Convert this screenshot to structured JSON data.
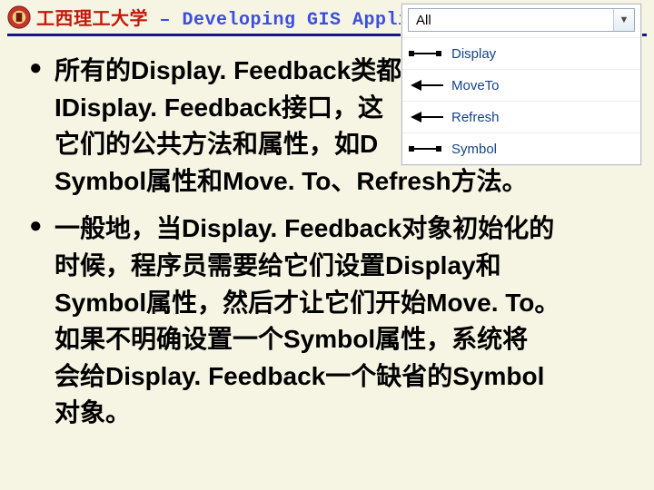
{
  "title": {
    "prefix": "工西理工大学",
    "main": " – Developing GIS Applications wit"
  },
  "bullets": [
    {
      "lines": [
        "所有的Display. Feedback类都",
        "IDisplay. Feedback接口，这",
        "它们的公共方法和属性，如D",
        "Symbol属性和Move. To、Refresh方法。"
      ]
    },
    {
      "lines": [
        "一般地，当Display. Feedback对象初始化的",
        "时候，程序员需要给它们设置Display和",
        "Symbol属性，然后才让它们开始Move. To。",
        "如果不明确设置一个Symbol属性，系统将",
        "会给Display. Feedback一个缺省的Symbol",
        "对象。"
      ]
    }
  ],
  "panel": {
    "filter": "All",
    "rows": [
      {
        "label": "Display",
        "kind": "property"
      },
      {
        "label": "MoveTo",
        "kind": "method"
      },
      {
        "label": "Refresh",
        "kind": "method"
      },
      {
        "label": "Symbol",
        "kind": "property"
      }
    ]
  }
}
